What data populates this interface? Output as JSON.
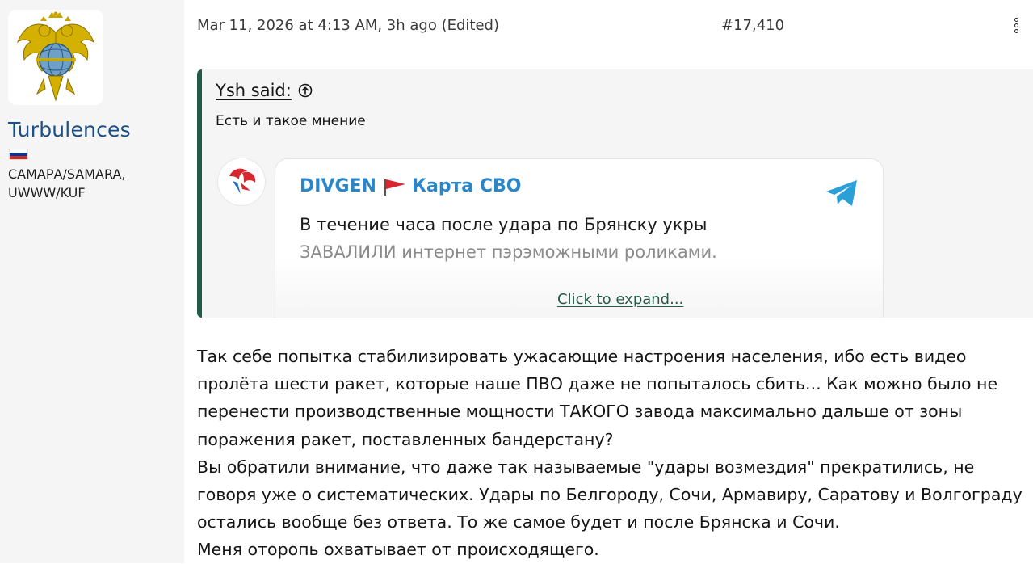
{
  "user": {
    "name": "Turbulences",
    "location_line1": "САМАРА/SAMARA,",
    "location_line2": "UWWW/KUF",
    "flag_colors": [
      "#ffffff",
      "#0039a6",
      "#d52b1e"
    ]
  },
  "message": {
    "date": "Mar 11, 2026 at 4:13 AM, 3h ago (Edited)",
    "number": "#17,410",
    "menu_icon": "vertical-ellipsis-icon"
  },
  "quote": {
    "author": "Ysh said:",
    "author_icon": "arrow-up-circle-icon",
    "text": "Есть и такое мнение",
    "embed": {
      "channel_name": "DIVGEN",
      "channel_suffix": "Карта СВО",
      "line1": "В течение часа после удара по Брянску укры",
      "line2": "ЗАВАЛИЛИ интернет пэрэможными роликами.",
      "icon": "telegram-icon"
    },
    "expand_label": "Click to expand..."
  },
  "post": {
    "paragraphs": [
      "Так себе попытка стабилизировать ужасающие настроения населения, ибо есть видео пролёта шести ракет, которые наше ПВО даже не попыталось сбить... Как можно было не перенести производственные мощности ТАКОГО завода максимально дальше от зоны поражения ракет, поставленных бандерстану?",
      "Вы обратили внимание, что даже так называемые \"удары возмездия\" прекратились, не говоря уже о систематических. Удары по Белгороду, Сочи, Армавиру, Саратову и Волгограду остались вообще без ответа. То же самое будет и после Брянска и Сочи.",
      "Меня оторопь охватывает от происходящего."
    ]
  },
  "colors": {
    "username": "#1a4f8a",
    "quote_border": "#245a4a",
    "telegram_blue": "#2a86c8"
  }
}
